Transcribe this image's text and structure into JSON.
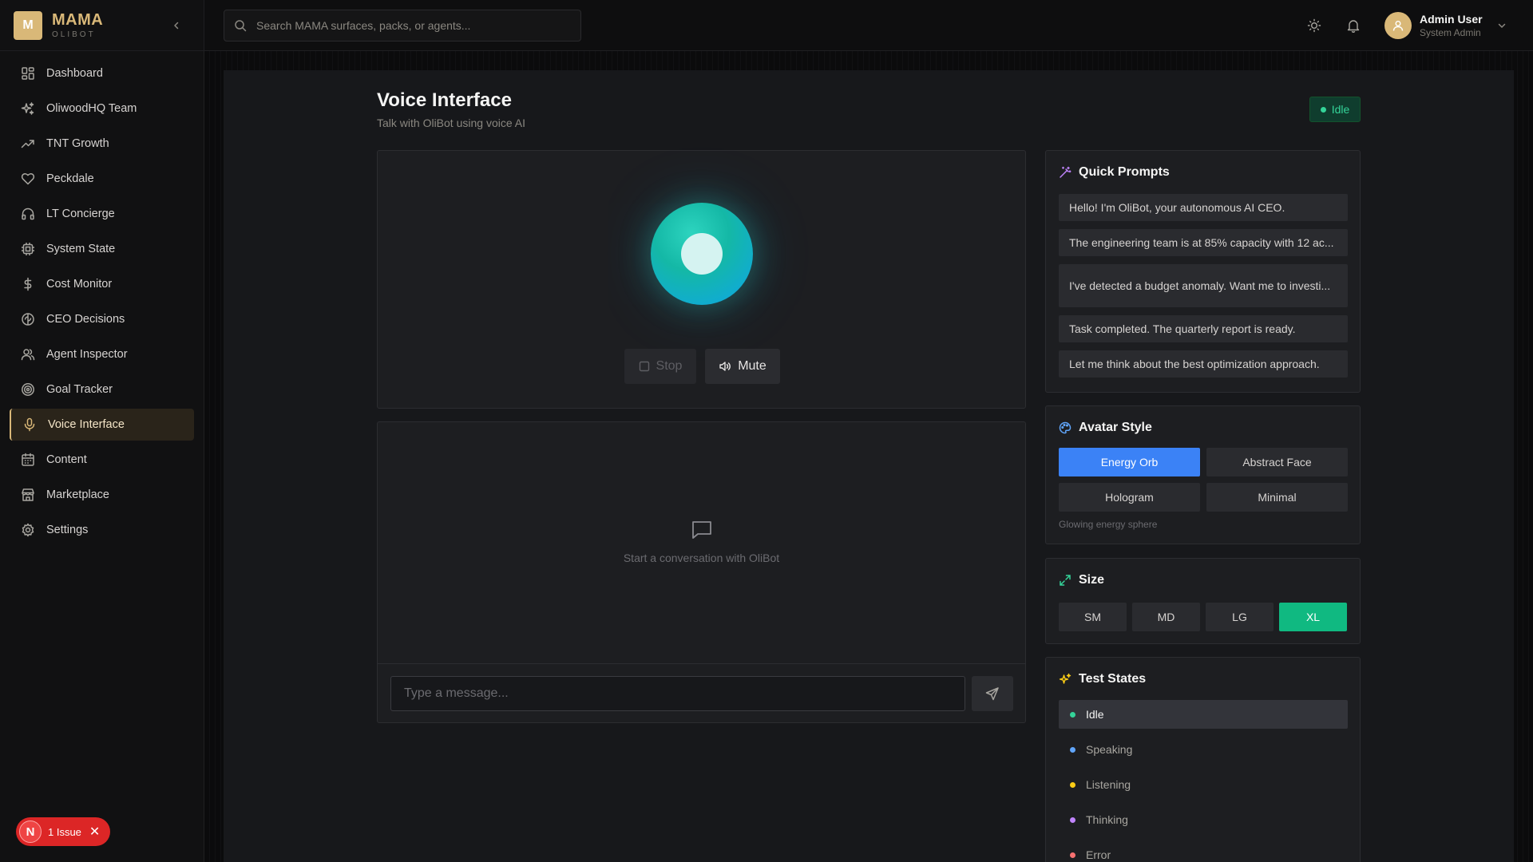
{
  "brand": {
    "logo_letter": "M",
    "name": "MAMA",
    "subtitle": "OLIBOT"
  },
  "sidebar": {
    "items": [
      {
        "label": "Dashboard",
        "icon": "dashboard-icon"
      },
      {
        "label": "OliwoodHQ Team",
        "icon": "sparkles-icon"
      },
      {
        "label": "TNT Growth",
        "icon": "trending-up-icon"
      },
      {
        "label": "Peckdale",
        "icon": "heart-icon"
      },
      {
        "label": "LT Concierge",
        "icon": "headphones-icon"
      },
      {
        "label": "System State",
        "icon": "cpu-icon"
      },
      {
        "label": "Cost Monitor",
        "icon": "dollar-icon"
      },
      {
        "label": "CEO Decisions",
        "icon": "brain-icon"
      },
      {
        "label": "Agent Inspector",
        "icon": "users-icon"
      },
      {
        "label": "Goal Tracker",
        "icon": "target-icon"
      },
      {
        "label": "Voice Interface",
        "icon": "mic-icon",
        "active": true
      },
      {
        "label": "Content",
        "icon": "calendar-icon"
      },
      {
        "label": "Marketplace",
        "icon": "store-icon"
      },
      {
        "label": "Settings",
        "icon": "gear-icon"
      }
    ]
  },
  "issue": {
    "letter": "N",
    "label": "1 Issue"
  },
  "topbar": {
    "search_placeholder": "Search MAMA surfaces, packs, or agents...",
    "user_name": "Admin User",
    "user_role": "System Admin"
  },
  "page": {
    "title": "Voice Interface",
    "subtitle": "Talk with OliBot using voice AI",
    "status": "Idle"
  },
  "controls": {
    "stop_label": "Stop",
    "mute_label": "Mute"
  },
  "chat": {
    "empty_text": "Start a conversation with OliBot",
    "input_placeholder": "Type a message..."
  },
  "quick_prompts": {
    "title": "Quick Prompts",
    "items": [
      "Hello! I'm OliBot, your autonomous AI CEO.",
      "The engineering team is at 85% capacity with 12 ac...",
      "I've detected a budget anomaly. Want me to investi...",
      "Task completed. The quarterly report is ready.",
      "Let me think about the best optimization approach."
    ]
  },
  "avatar_style": {
    "title": "Avatar Style",
    "options": [
      "Energy Orb",
      "Abstract Face",
      "Hologram",
      "Minimal"
    ],
    "selected": "Energy Orb",
    "description": "Glowing energy sphere"
  },
  "size": {
    "title": "Size",
    "options": [
      "SM",
      "MD",
      "LG",
      "XL"
    ],
    "selected": "XL"
  },
  "test_states": {
    "title": "Test States",
    "items": [
      {
        "label": "Idle",
        "color": "#34d399",
        "active": true
      },
      {
        "label": "Speaking",
        "color": "#60a5fa"
      },
      {
        "label": "Listening",
        "color": "#facc15"
      },
      {
        "label": "Thinking",
        "color": "#c084fc"
      },
      {
        "label": "Error",
        "color": "#f87171"
      }
    ]
  },
  "colors": {
    "accent_gold": "#d9b878",
    "selected_blue": "#3b82f6",
    "selected_green": "#10b981",
    "status_green": "#34d399"
  }
}
